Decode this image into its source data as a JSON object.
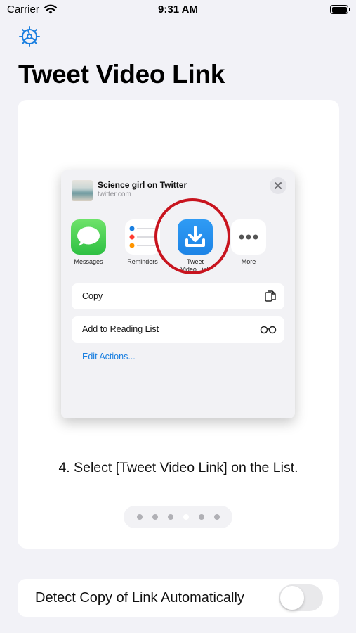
{
  "status_bar": {
    "carrier": "Carrier",
    "time": "9:31 AM"
  },
  "header": {
    "title": "Tweet Video Link",
    "settings_icon": "gear-icon"
  },
  "tutorial": {
    "share_sheet": {
      "title": "Science girl on Twitter",
      "url": "twitter.com",
      "apps": [
        {
          "label": "Messages",
          "icon": "messages-icon"
        },
        {
          "label": "Reminders",
          "icon": "reminders-icon"
        },
        {
          "label": "Tweet\nVideo Link",
          "icon": "download-icon"
        },
        {
          "label": "More",
          "icon": "more-icon"
        }
      ],
      "actions": [
        {
          "label": "Copy",
          "icon": "copy-icon"
        },
        {
          "label": "Add to Reading List",
          "icon": "glasses-icon"
        }
      ],
      "edit_actions": "Edit Actions..."
    },
    "step_text": "4. Select [Tweet Video Link] on the List.",
    "pager": {
      "total": 6,
      "current_index": 3
    }
  },
  "auto_detect": {
    "label": "Detect Copy of Link Automatically",
    "enabled": false
  },
  "colors": {
    "accent": "#1a7fe0",
    "highlight_ring": "#c8141e",
    "background": "#f2f2f7"
  }
}
